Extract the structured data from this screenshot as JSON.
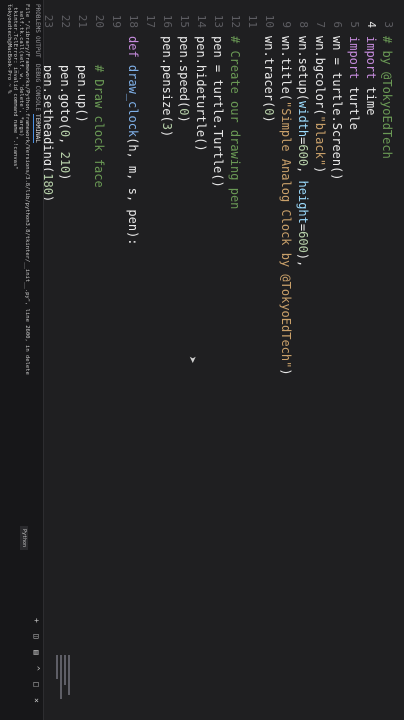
{
  "editor": {
    "top_fragment": "# by @TokyoEdTech",
    "lines": [
      {
        "n": "3",
        "html": ""
      },
      {
        "n": "4",
        "current": true,
        "parts": [
          [
            "kw",
            "import "
          ],
          [
            "",
            "time"
          ]
        ]
      },
      {
        "n": "5",
        "parts": [
          [
            "kw",
            "import "
          ],
          [
            "",
            "turtle"
          ]
        ]
      },
      {
        "n": "6",
        "parts": [
          [
            "",
            "wn = turtle.Screen()"
          ]
        ]
      },
      {
        "n": "7",
        "parts": [
          [
            "",
            "wn.bgcolor("
          ],
          [
            "str",
            "\"black\""
          ],
          [
            "",
            ")"
          ]
        ]
      },
      {
        "n": "8",
        "parts": [
          [
            "",
            "wn.setup("
          ],
          [
            "par",
            "width"
          ],
          [
            "",
            "="
          ],
          [
            "num",
            "600"
          ],
          [
            "",
            ", "
          ],
          [
            "par",
            "height"
          ],
          [
            "",
            "="
          ],
          [
            "num",
            "600"
          ],
          [
            "",
            "),"
          ]
        ]
      },
      {
        "n": "9",
        "parts": [
          [
            "",
            "wn.title("
          ],
          [
            "str",
            "\"Simple Analog Clock by @TokyoEdTech\""
          ],
          [
            "",
            ")"
          ]
        ]
      },
      {
        "n": "10",
        "parts": [
          [
            "",
            "wn.tracer("
          ],
          [
            "num",
            "0"
          ],
          [
            "",
            ")"
          ]
        ]
      },
      {
        "n": "11",
        "parts": [
          [
            "",
            ""
          ]
        ]
      },
      {
        "n": "12",
        "parts": [
          [
            "cm",
            "# Create our drawing pen"
          ]
        ]
      },
      {
        "n": "13",
        "parts": [
          [
            "",
            "pen = turtle.Turtle()"
          ]
        ]
      },
      {
        "n": "14",
        "parts": [
          [
            "",
            "pen.hideturtle()"
          ]
        ]
      },
      {
        "n": "15",
        "parts": [
          [
            "",
            "pen.speed("
          ],
          [
            "num",
            "0"
          ],
          [
            "",
            ")"
          ]
        ]
      },
      {
        "n": "16",
        "parts": [
          [
            "",
            "pen.pensize("
          ],
          [
            "num",
            "3"
          ],
          [
            "",
            ")"
          ]
        ]
      },
      {
        "n": "17",
        "parts": [
          [
            "",
            ""
          ]
        ]
      },
      {
        "n": "18",
        "parts": [
          [
            "kw",
            "def "
          ],
          [
            "fn",
            "draw_clock"
          ],
          [
            "",
            "(h, m, s, pen):"
          ]
        ]
      },
      {
        "n": "19",
        "parts": [
          [
            "",
            ""
          ]
        ]
      },
      {
        "n": "20",
        "parts": [
          [
            "cm",
            "    # Draw clock face"
          ]
        ]
      },
      {
        "n": "21",
        "parts": [
          [
            "",
            "    pen.up()"
          ]
        ]
      },
      {
        "n": "22",
        "parts": [
          [
            "",
            "    pen.goto("
          ],
          [
            "num",
            "0"
          ],
          [
            "",
            ", "
          ],
          [
            "num",
            "210"
          ],
          [
            "",
            ")"
          ]
        ]
      },
      {
        "n": "23",
        "parts": [
          [
            "",
            "    pen.setheading("
          ],
          [
            "num",
            "180"
          ],
          [
            "",
            ")"
          ]
        ]
      }
    ]
  },
  "panel": {
    "tabs": [
      "PROBLEMS",
      "OUTPUT",
      "DEBUG CONSOLE",
      "TERMINAL"
    ],
    "active_tab": "TERMINAL",
    "python_label": "Python",
    "terminal_lines": [
      "File \"/Library/Frameworks/Python.framework/Versions/3.8/lib/python3.8/tkinter/__init__.py\", line 2600, in delete",
      "  self.tk.call(self._w, 'delete', *args)",
      "_tkinter.TclError: invalid command name \".!canvas\"",
      "tokyoedtech@MacBook-Pro ~ % "
    ]
  }
}
